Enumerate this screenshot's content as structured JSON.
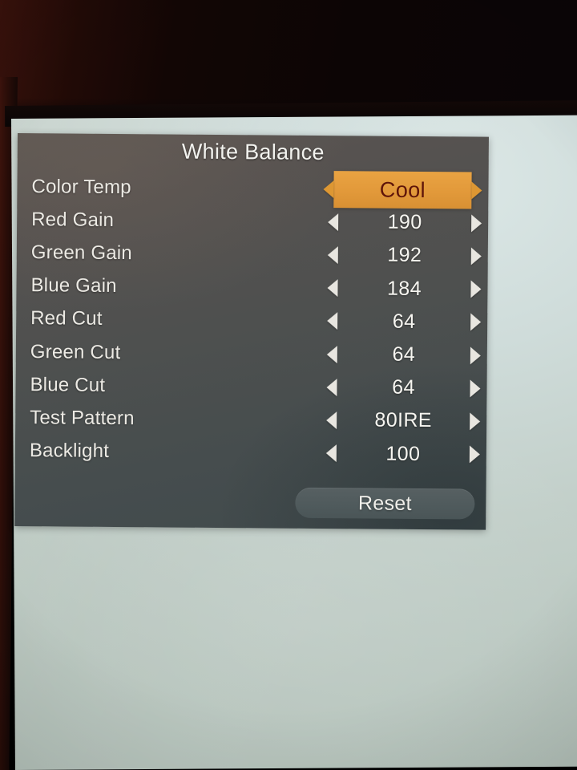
{
  "menu": {
    "title": "White Balance",
    "rows": [
      {
        "label": "Color Temp",
        "value": "Cool",
        "selected": true,
        "left_arrow": "triangle-left-icon",
        "right_arrow": "triangle-right-icon"
      },
      {
        "label": "Red Gain",
        "value": "190",
        "selected": false,
        "left_arrow": "triangle-left-icon",
        "right_arrow": "triangle-right-icon"
      },
      {
        "label": "Green Gain",
        "value": "192",
        "selected": false,
        "left_arrow": "triangle-left-icon",
        "right_arrow": "triangle-right-icon"
      },
      {
        "label": "Blue Gain",
        "value": "184",
        "selected": false,
        "left_arrow": "triangle-left-icon",
        "right_arrow": "triangle-right-icon"
      },
      {
        "label": "Red Cut",
        "value": "64",
        "selected": false,
        "left_arrow": "triangle-left-icon",
        "right_arrow": "triangle-right-icon"
      },
      {
        "label": "Green Cut",
        "value": "64",
        "selected": false,
        "left_arrow": "triangle-left-icon",
        "right_arrow": "triangle-right-icon"
      },
      {
        "label": "Blue Cut",
        "value": "64",
        "selected": false,
        "left_arrow": "triangle-left-icon",
        "right_arrow": "triangle-right-icon"
      },
      {
        "label": "Test Pattern",
        "value": "80IRE",
        "selected": false,
        "left_arrow": "triangle-left-icon",
        "right_arrow": "triangle-right-icon"
      },
      {
        "label": "Backlight",
        "value": "100",
        "selected": false,
        "left_arrow": "triangle-left-icon",
        "right_arrow": "triangle-right-icon"
      }
    ],
    "reset_label": "Reset"
  },
  "colors": {
    "highlight_bg": "#e2993a",
    "highlight_text": "#5e1409",
    "panel_text": "#eceae4",
    "panel_bg_top": "#5d5753",
    "panel_bg_bottom": "#404a4c",
    "screen_bg": "#cfdcda",
    "reset_bg": "#4f5a5c"
  }
}
